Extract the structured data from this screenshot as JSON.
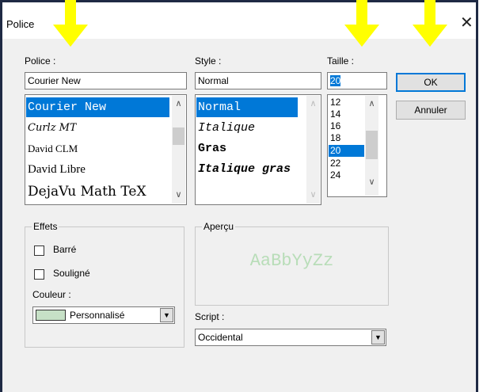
{
  "window": {
    "title": "Police",
    "close_glyph": "✕"
  },
  "font": {
    "label": "Police :",
    "value": "Courier New",
    "items": [
      "Courier New",
      "Curlz MT",
      "David CLM",
      "David Libre",
      "DejaVu Math TeX"
    ],
    "selected_index": 0
  },
  "style": {
    "label": "Style :",
    "value": "Normal",
    "items": [
      "Normal",
      "Italique",
      "Gras",
      "Italique gras"
    ],
    "selected_index": 0
  },
  "size": {
    "label": "Taille :",
    "value": "20",
    "items": [
      "12",
      "14",
      "16",
      "18",
      "20",
      "22",
      "24"
    ],
    "selected_index": 4
  },
  "buttons": {
    "ok": "OK",
    "cancel": "Annuler"
  },
  "effects": {
    "legend": "Effets",
    "strike": "Barré",
    "underline": "Souligné",
    "color_label": "Couleur :",
    "color_value": "Personnalisé",
    "color_swatch": "#c6e0c6"
  },
  "preview": {
    "legend": "Aperçu",
    "sample": "AaBbYyZz",
    "sample_color": "#b8ddb8"
  },
  "script": {
    "label": "Script :",
    "value": "Occidental"
  },
  "colors": {
    "selection": "#0078d7",
    "arrow": "#ffff00",
    "window_bg": "#f0f0f0"
  }
}
